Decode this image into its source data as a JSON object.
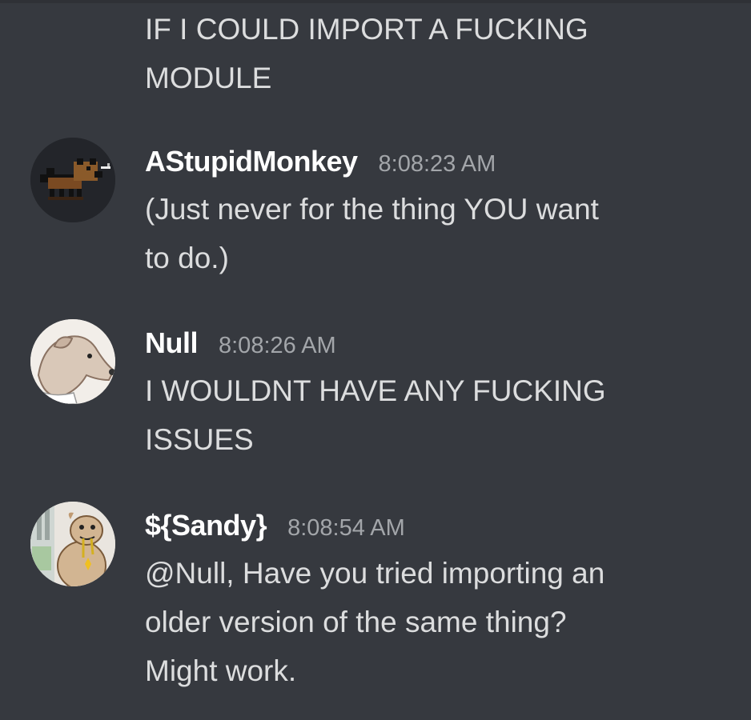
{
  "messages": [
    {
      "content": "IF I COULD IMPORT A FUCKING\nMODULE"
    },
    {
      "author": "AStupidMonkey",
      "timestamp": "8:08:23 AM",
      "avatar_icon": "pixel-dog-avatar-icon",
      "content": "(Just never for the thing YOU want\nto do.)"
    },
    {
      "author": "Null",
      "timestamp": "8:08:26 AM",
      "avatar_icon": "dog-sketch-avatar-icon",
      "content": "I WOULDNT HAVE ANY FUCKING\nISSUES"
    },
    {
      "author": "${Sandy}",
      "timestamp": "8:08:54 AM",
      "avatar_icon": "cartoon-dog-avatar-icon",
      "content": "@Null, Have you tried importing an\nolder version of the same thing?\nMight work."
    }
  ],
  "colors": {
    "background": "#36393f",
    "username": "#ffffff",
    "timestamp": "#a3a6aa",
    "text": "#dcddde"
  }
}
